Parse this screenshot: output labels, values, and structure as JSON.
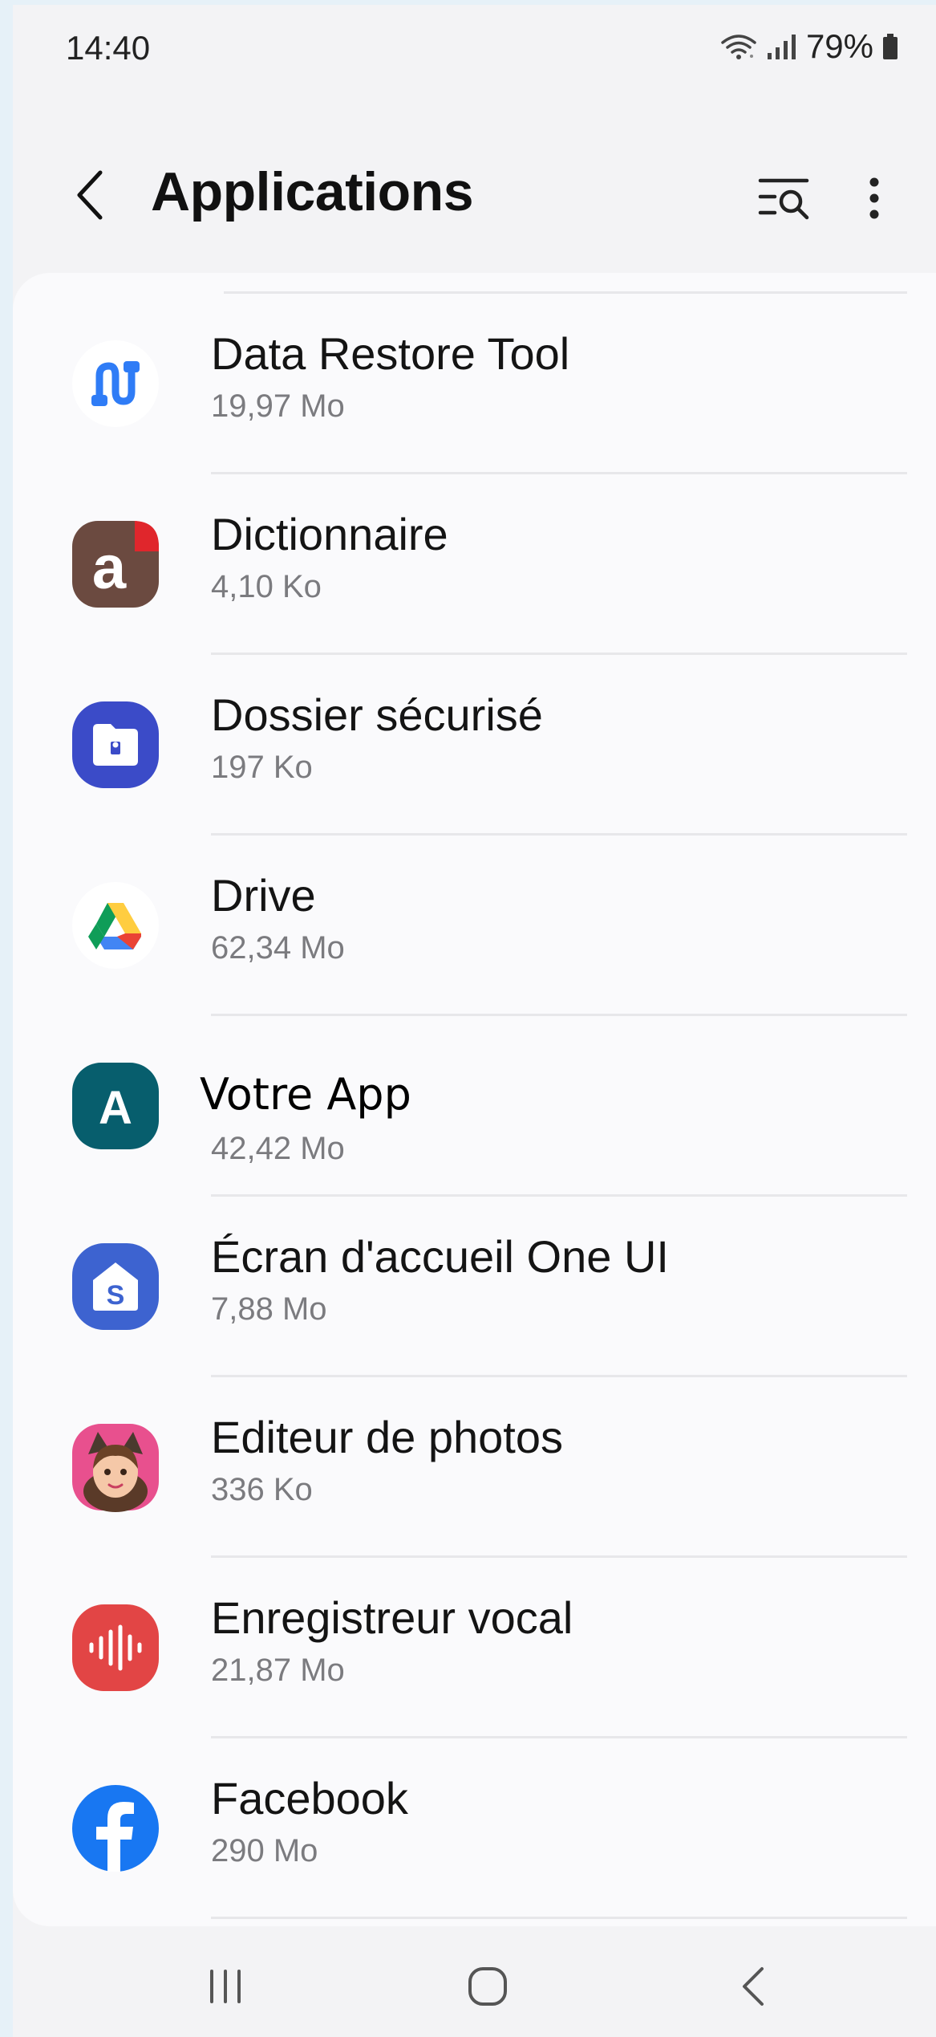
{
  "status_bar": {
    "time": "14:40",
    "battery_percent": "79%"
  },
  "header": {
    "title": "Applications"
  },
  "apps": [
    {
      "name": "Data Restore Tool",
      "size": "19,97 Mo",
      "icon": "data-restore-icon"
    },
    {
      "name": "Dictionnaire",
      "size": "4,10 Ko",
      "icon": "dictionary-icon"
    },
    {
      "name": "Dossier sécurisé",
      "size": "197 Ko",
      "icon": "secure-folder-icon"
    },
    {
      "name": "Drive",
      "size": "62,34 Mo",
      "icon": "drive-icon"
    },
    {
      "name": "Votre App",
      "size": "42,42 Mo",
      "icon": "votre-app-icon"
    },
    {
      "name": "Écran d'accueil One UI",
      "size": "7,88 Mo",
      "icon": "one-ui-home-icon"
    },
    {
      "name": "Editeur de photos",
      "size": "336 Ko",
      "icon": "photo-editor-icon"
    },
    {
      "name": "Enregistreur vocal",
      "size": "21,87 Mo",
      "icon": "voice-recorder-icon"
    },
    {
      "name": "Facebook",
      "size": "290 Mo",
      "icon": "facebook-icon"
    }
  ],
  "icon_letters": {
    "dictionary": "a",
    "votre_app": "A",
    "one_ui": "S"
  },
  "colors": {
    "background": "#f3f3f5",
    "card": "#fafafc",
    "secondary_text": "#7b7b7f",
    "dictionary": "#6b4a40",
    "secure_folder": "#3b4bc8",
    "votre_app": "#075e6d",
    "one_ui": "#3d63d0",
    "photo_editor": "#e8508e",
    "voice_recorder": "#e24545",
    "facebook": "#1877f2"
  }
}
